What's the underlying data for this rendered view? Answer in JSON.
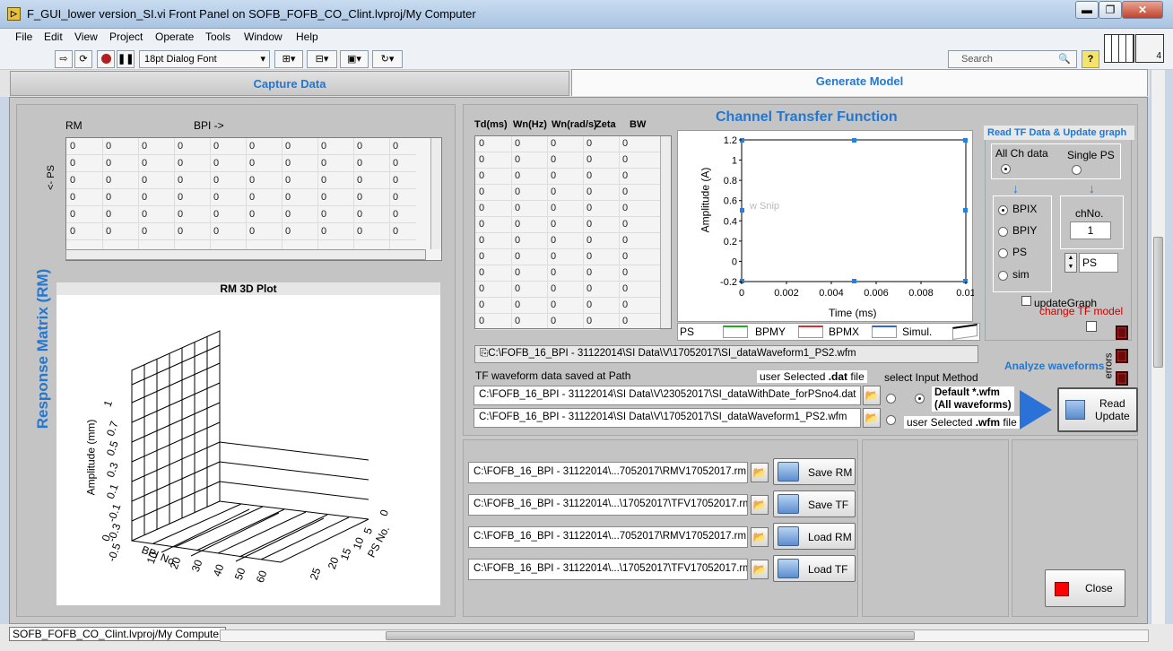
{
  "window": {
    "title": "F_GUI_lower version_SI.vi Front Panel on SOFB_FOFB_CO_Clint.lvproj/My Computer",
    "min": "▬",
    "max": "❐",
    "close": "✕"
  },
  "menu": [
    "File",
    "Edit",
    "View",
    "Project",
    "Operate",
    "Tools",
    "Window",
    "Help"
  ],
  "toolbar": {
    "font": "18pt Dialog Font",
    "search_placeholder": "Search",
    "help": "?",
    "count": "4"
  },
  "tabs": {
    "capture": "Capture Data",
    "generate": "Generate Model"
  },
  "rm": {
    "vertical_title": "Response Matrix (RM)",
    "rm_label": "RM",
    "bpi_label": "BPI ->",
    "ps_label": "<- PS",
    "rows": [
      [
        "0",
        "0",
        "0",
        "0",
        "0",
        "0",
        "0",
        "0",
        "0",
        "0"
      ],
      [
        "0",
        "0",
        "0",
        "0",
        "0",
        "0",
        "0",
        "0",
        "0",
        "0"
      ],
      [
        "0",
        "0",
        "0",
        "0",
        "0",
        "0",
        "0",
        "0",
        "0",
        "0"
      ],
      [
        "0",
        "0",
        "0",
        "0",
        "0",
        "0",
        "0",
        "0",
        "0",
        "0"
      ],
      [
        "0",
        "0",
        "0",
        "0",
        "0",
        "0",
        "0",
        "0",
        "0",
        "0"
      ],
      [
        "0",
        "0",
        "0",
        "0",
        "0",
        "0",
        "0",
        "0",
        "0",
        "0"
      ]
    ]
  },
  "plot3d": {
    "title": "RM 3D Plot",
    "zlabel": "Amplitude (mm)",
    "xlabel": "BPI No.",
    "ylabel": "PS No.",
    "zticks": [
      "1",
      "0.7",
      "0.5",
      "0.3",
      "0.1",
      "-0.1",
      "-0.3",
      "-0.5",
      "0"
    ],
    "xticks": [
      "0",
      "10",
      "20",
      "30",
      "40",
      "50",
      "60"
    ],
    "yticks": [
      "0",
      "5",
      "10",
      "15",
      "20",
      "25"
    ]
  },
  "tf": {
    "title": "Channel Transfer Function",
    "headers": [
      "Td(ms)",
      "Wn(Hz)",
      "Wn(rad/s)",
      "Zeta",
      "BW"
    ],
    "rows": [
      [
        "0",
        "0",
        "0",
        "0",
        "0"
      ],
      [
        "0",
        "0",
        "0",
        "0",
        "0"
      ],
      [
        "0",
        "0",
        "0",
        "0",
        "0"
      ],
      [
        "0",
        "0",
        "0",
        "0",
        "0"
      ],
      [
        "0",
        "0",
        "0",
        "0",
        "0"
      ],
      [
        "0",
        "0",
        "0",
        "0",
        "0"
      ],
      [
        "0",
        "0",
        "0",
        "0",
        "0"
      ],
      [
        "0",
        "0",
        "0",
        "0",
        "0"
      ],
      [
        "0",
        "0",
        "0",
        "0",
        "0"
      ],
      [
        "0",
        "0",
        "0",
        "0",
        "0"
      ],
      [
        "0",
        "0",
        "0",
        "0",
        "0"
      ],
      [
        "0",
        "0",
        "0",
        "0",
        "0"
      ]
    ],
    "ghost": "w Snip"
  },
  "chart_data": {
    "type": "line",
    "xlabel": "Time (ms)",
    "ylabel": "Amplitude (A)",
    "xlim": [
      0,
      0.01
    ],
    "ylim": [
      -0.2,
      1.2
    ],
    "xticks": [
      "0",
      "0.002",
      "0.004",
      "0.006",
      "0.008",
      "0.01"
    ],
    "yticks": [
      "1.2",
      "1",
      "0.8",
      "0.6",
      "0.4",
      "0.2",
      "0",
      "-0.2"
    ],
    "grid": false,
    "legend": [
      {
        "name": "PS",
        "color": "#000000"
      },
      {
        "name": "BPMY",
        "color": "#22aa22"
      },
      {
        "name": "BPMX",
        "color": "#cc3333"
      },
      {
        "name": "Simul.",
        "color": "#3366cc"
      }
    ]
  },
  "read_tf": {
    "title": "Read TF Data & Update graph",
    "all": "All Ch data",
    "single": "Single PS",
    "opts": [
      "BPIX",
      "BPIY",
      "PS",
      "sim"
    ],
    "chno_label": "chNo.",
    "chno": "1",
    "ps_value": "PS",
    "update": "updateGraph",
    "change": "change TF model",
    "errors": "errors"
  },
  "paths": {
    "top": "C:\\FOFB_16_BPI - 31122014\\SI Data\\V\\17052017\\SI_dataWaveform1_PS2.wfm",
    "saved_label": "TF waveform data saved at Path",
    "user_dat_a": "user Selected ",
    "user_dat_b": ".dat",
    " user_dat_c": " file",
    "dat": "C:\\FOFB_16_BPI - 31122014\\SI Data\\V\\23052017\\SI_dataWithDate_forPSno4.dat",
    "wfm": "C:\\FOFB_16_BPI - 31122014\\SI Data\\V\\17052017\\SI_dataWaveform1_PS2.wfm",
    "method": "select Input Method",
    "default_a": "Default *.wfm",
    "default_b": "(All waveforms)",
    "user_wfm_a": "user Selected ",
    "user_wfm_b": ".wfm",
    " user_wfm_c": " file",
    "analyze": "Analyze waveforms",
    "read_a": "Read",
    "read_b": "Update"
  },
  "files": [
    {
      "path": "C:\\FOFB_16_BPI - 31122014\\...7052017\\RMV17052017.rm",
      "btn": "Save RM"
    },
    {
      "path": "C:\\FOFB_16_BPI - 31122014\\...\\17052017\\TFV17052017.rm",
      "btn": "Save TF"
    },
    {
      "path": "C:\\FOFB_16_BPI - 31122014\\...7052017\\RMV17052017.rm",
      "btn": "Load RM"
    },
    {
      "path": "C:\\FOFB_16_BPI - 31122014\\...\\17052017\\TFV17052017.rm",
      "btn": "Load TF"
    }
  ],
  "close": "Close",
  "status": "SOFB_FOFB_CO_Clint.lvproj/My Computer"
}
